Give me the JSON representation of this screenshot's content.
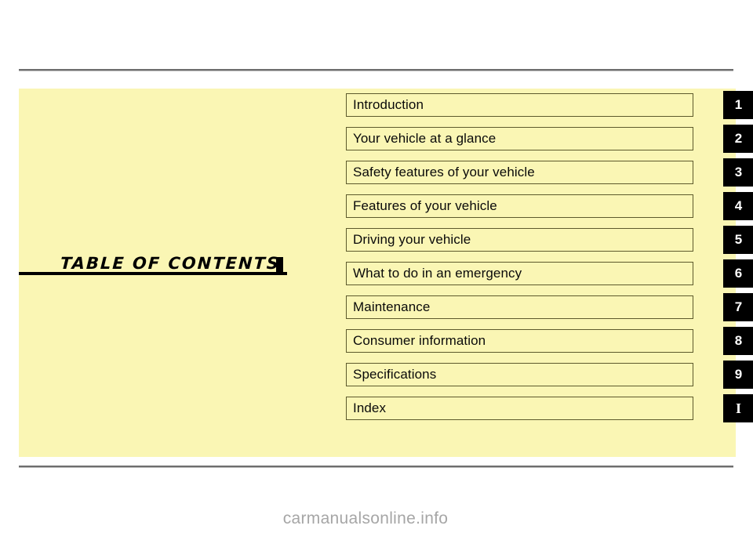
{
  "page": {
    "title": "TABLE  OF  CONTENTS",
    "background_color": "#ffffff",
    "panel_color": "#faf6b4",
    "badge_color": "#000000",
    "badge_text_color": "#ffffff",
    "rule_color": "#6e6e6e"
  },
  "contents": {
    "items": [
      {
        "label": "Introduction",
        "badge": "1"
      },
      {
        "label": "Your vehicle at a glance",
        "badge": "2"
      },
      {
        "label": "Safety features of your vehicle",
        "badge": "3"
      },
      {
        "label": "Features of your vehicle",
        "badge": "4"
      },
      {
        "label": "Driving your vehicle",
        "badge": "5"
      },
      {
        "label": "What to do in an emergency",
        "badge": "6"
      },
      {
        "label": "Maintenance",
        "badge": "7"
      },
      {
        "label": "Consumer information",
        "badge": "8"
      },
      {
        "label": "Specifications",
        "badge": "9"
      },
      {
        "label": "Index",
        "badge": "I"
      }
    ]
  },
  "watermark": {
    "text": "carmanualsonline.info",
    "color": "#a6a6a6"
  }
}
